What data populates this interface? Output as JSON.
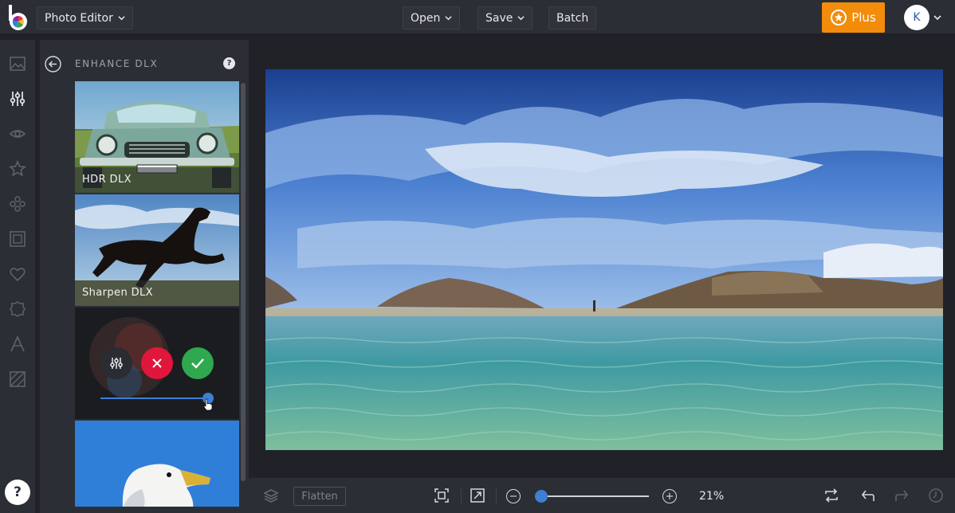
{
  "topbar": {
    "app_menu_label": "Photo Editor",
    "open_label": "Open",
    "save_label": "Save",
    "batch_label": "Batch",
    "plus_label": "Plus",
    "avatar_initial": "K"
  },
  "rail": {
    "icons": [
      "image-icon",
      "sliders-icon",
      "eye-icon",
      "star-icon",
      "shapes-icon",
      "frame-icon",
      "heart-icon",
      "badge-icon",
      "text-icon",
      "texture-icon"
    ],
    "active": "sliders-icon",
    "help_label": "?"
  },
  "panel": {
    "title": "ENHANCE DLX",
    "help_label": "?",
    "effects": [
      {
        "label": "HDR DLX"
      },
      {
        "label": "Sharpen DLX"
      }
    ],
    "active_effect_strength": 1.0
  },
  "bottombar": {
    "flatten_label": "Flatten",
    "zoom_percent": "21%",
    "zoom_level": 0.0
  },
  "colors": {
    "accent": "#3d7fd4",
    "plus": "#f28c0a",
    "cancel": "#e0173a",
    "apply": "#2fa84f"
  }
}
